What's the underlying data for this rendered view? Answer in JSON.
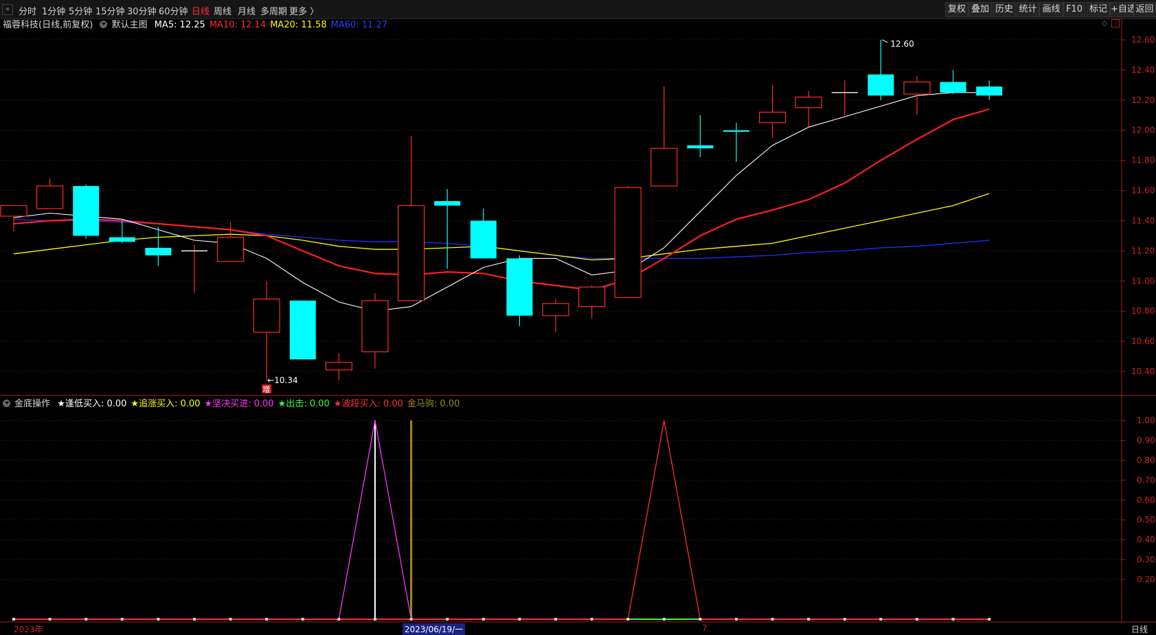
{
  "toolbar": {
    "timeframes": [
      "分时",
      "1分钟",
      "5分钟",
      "15分钟",
      "30分钟",
      "60分钟",
      "日线",
      "周线",
      "月线",
      "多周期",
      "更多 〉"
    ],
    "active_timeframe": "日线",
    "right_buttons": [
      "复权",
      "叠加",
      "历史",
      "统计",
      "画线",
      "F10",
      "标记",
      "+自选",
      "返回"
    ]
  },
  "main_header": {
    "stock": "福蓉科技(日线,前复权)",
    "template": "默认主图",
    "ma": [
      {
        "label": "MA5: 12.25",
        "color": "#ffffff"
      },
      {
        "label": "MA10: 12.14",
        "color": "#ff2b2b"
      },
      {
        "label": "MA20: 11.58",
        "color": "#ffff00"
      },
      {
        "label": "MA60: 11.27",
        "color": "#2f3cff"
      }
    ]
  },
  "sub_header": {
    "name": "金底操作",
    "items": [
      {
        "label": "★逢低买入: 0.00",
        "color": "#ffffff"
      },
      {
        "label": "★追涨买入: 0.00",
        "color": "#ffff00"
      },
      {
        "label": "★坚决买进: 0.00",
        "color": "#ff33ff"
      },
      {
        "label": "★出击: 0.00",
        "color": "#33ff33"
      },
      {
        "label": "★波段买入: 0.00",
        "color": "#ff3030"
      },
      {
        "label": "金马驹: 0.00",
        "color": "#a08a20"
      }
    ]
  },
  "chart_data": [
    {
      "type": "candlestick",
      "title": "福蓉科技(日线,前复权)",
      "y_ticks": [
        "12.60",
        "12.40",
        "12.20",
        "12.00",
        "11.80",
        "11.60",
        "11.40",
        "11.20",
        "11.00",
        "10.80",
        "10.60",
        "10.40"
      ],
      "ylim": [
        10.25,
        12.7
      ],
      "candles": [
        {
          "o": 11.43,
          "h": 11.5,
          "l": 11.33,
          "c": 11.5
        },
        {
          "o": 11.48,
          "h": 11.68,
          "l": 11.48,
          "c": 11.63
        },
        {
          "o": 11.63,
          "h": 11.64,
          "l": 11.28,
          "c": 11.3
        },
        {
          "o": 11.29,
          "h": 11.4,
          "l": 11.25,
          "c": 11.26
        },
        {
          "o": 11.22,
          "h": 11.36,
          "l": 11.1,
          "c": 11.17
        },
        {
          "o": 11.2,
          "h": 11.24,
          "l": 10.92,
          "c": 11.2
        },
        {
          "o": 11.13,
          "h": 11.39,
          "l": 11.13,
          "c": 11.29
        },
        {
          "o": 10.66,
          "h": 11.0,
          "l": 10.34,
          "c": 10.88
        },
        {
          "o": 10.87,
          "h": 10.87,
          "l": 10.48,
          "c": 10.48
        },
        {
          "o": 10.41,
          "h": 10.52,
          "l": 10.34,
          "c": 10.46
        },
        {
          "o": 10.53,
          "h": 10.92,
          "l": 10.42,
          "c": 10.87
        },
        {
          "o": 10.87,
          "h": 11.96,
          "l": 10.87,
          "c": 11.5
        },
        {
          "o": 11.53,
          "h": 11.61,
          "l": 11.08,
          "c": 11.5
        },
        {
          "o": 11.4,
          "h": 11.48,
          "l": 11.15,
          "c": 11.15
        },
        {
          "o": 11.15,
          "h": 11.17,
          "l": 10.7,
          "c": 10.77
        },
        {
          "o": 10.77,
          "h": 10.88,
          "l": 10.66,
          "c": 10.85
        },
        {
          "o": 10.83,
          "h": 10.97,
          "l": 10.75,
          "c": 10.96
        },
        {
          "o": 10.89,
          "h": 11.63,
          "l": 10.89,
          "c": 11.62
        },
        {
          "o": 11.63,
          "h": 12.29,
          "l": 11.63,
          "c": 11.88
        },
        {
          "o": 11.9,
          "h": 12.1,
          "l": 11.82,
          "c": 11.88
        },
        {
          "o": 12.0,
          "h": 12.05,
          "l": 11.79,
          "c": 11.99
        },
        {
          "o": 12.05,
          "h": 12.3,
          "l": 11.95,
          "c": 12.12
        },
        {
          "o": 12.15,
          "h": 12.26,
          "l": 12.02,
          "c": 12.22
        },
        {
          "o": 12.25,
          "h": 12.33,
          "l": 12.1,
          "c": 12.25
        },
        {
          "o": 12.37,
          "h": 12.6,
          "l": 12.2,
          "c": 12.23
        },
        {
          "o": 12.24,
          "h": 12.36,
          "l": 12.1,
          "c": 12.32
        },
        {
          "o": 12.32,
          "h": 12.4,
          "l": 12.24,
          "c": 12.25
        },
        {
          "o": 12.29,
          "h": 12.33,
          "l": 12.2,
          "c": 12.23
        }
      ],
      "ma5": [
        11.42,
        11.45,
        11.43,
        11.41,
        11.34,
        11.27,
        11.25,
        11.15,
        10.99,
        10.86,
        10.8,
        10.83,
        10.96,
        11.09,
        11.15,
        11.15,
        11.04,
        11.07,
        11.22,
        11.46,
        11.7,
        11.9,
        12.02,
        12.09,
        12.16,
        12.23,
        12.25,
        12.25
      ],
      "ma10": [
        11.38,
        11.4,
        11.41,
        11.4,
        11.38,
        11.36,
        11.34,
        11.3,
        11.2,
        11.1,
        11.05,
        11.04,
        11.06,
        11.05,
        11.0,
        10.97,
        10.94,
        11.01,
        11.15,
        11.3,
        11.41,
        11.47,
        11.54,
        11.65,
        11.8,
        11.94,
        12.07,
        12.14
      ],
      "ma20": [
        11.18,
        11.21,
        11.24,
        11.27,
        11.29,
        11.3,
        11.31,
        11.3,
        11.27,
        11.23,
        11.21,
        11.21,
        11.22,
        11.23,
        11.2,
        11.17,
        11.14,
        11.15,
        11.18,
        11.21,
        11.23,
        11.25,
        11.3,
        11.35,
        11.4,
        11.45,
        11.5,
        11.58
      ],
      "ma60": [
        11.41,
        11.4,
        11.4,
        11.39,
        11.38,
        11.36,
        11.34,
        11.31,
        11.29,
        11.27,
        11.26,
        11.26,
        11.25,
        11.23,
        11.2,
        11.17,
        11.15,
        11.15,
        11.15,
        11.15,
        11.16,
        11.17,
        11.19,
        11.2,
        11.22,
        11.23,
        11.25,
        11.27
      ],
      "annotations": [
        {
          "label": "12.60",
          "index": 24,
          "value": 12.6
        },
        {
          "label": "←10.34",
          "index": 7,
          "value": 10.34
        },
        {
          "label": "增",
          "index": 7
        }
      ]
    },
    {
      "type": "line",
      "title": "金底操作",
      "y_ticks": [
        "1.00",
        "0.90",
        "0.80",
        "0.70",
        "0.60",
        "0.50",
        "0.40",
        "0.30",
        "0.20"
      ],
      "ylim": [
        0,
        1.05
      ],
      "series": [
        {
          "name": "★逢低买入",
          "color": "#ffffff",
          "values": [
            0,
            0,
            0,
            0,
            0,
            0,
            0,
            0,
            0,
            0,
            1,
            0,
            0,
            0,
            0,
            0,
            0,
            0,
            0,
            0,
            0,
            0,
            0,
            0,
            0,
            0,
            0,
            0
          ]
        },
        {
          "name": "★追涨买入",
          "color": "#ffff00",
          "values": [
            0,
            0,
            0,
            0,
            0,
            0,
            0,
            0,
            0,
            0,
            0,
            1,
            0,
            0,
            0,
            0,
            0,
            0,
            0,
            0,
            0,
            0,
            0,
            0,
            0,
            0,
            0,
            0
          ]
        },
        {
          "name": "★坚决买进",
          "color": "#ff33ff",
          "values": [
            0,
            0,
            0,
            0,
            0,
            0,
            0,
            0,
            0,
            0,
            1,
            0,
            0,
            0,
            0,
            0,
            0,
            0,
            0,
            0,
            0,
            0,
            0,
            0,
            0,
            0,
            0,
            0
          ]
        },
        {
          "name": "★出击",
          "color": "#33ff33",
          "values": [
            0,
            0,
            0,
            0,
            0,
            0,
            0,
            0,
            0,
            0,
            0,
            0,
            0,
            0,
            0,
            0,
            0,
            0,
            0,
            0,
            0,
            0,
            0,
            0,
            0,
            0,
            0,
            0
          ]
        },
        {
          "name": "★波段买入",
          "color": "#ff3030",
          "values": [
            0,
            0,
            0,
            0,
            0,
            0,
            0,
            0,
            0,
            0,
            0,
            0,
            0,
            0,
            0,
            0,
            0,
            0,
            1,
            0,
            0,
            0,
            0,
            0,
            0,
            0,
            0,
            0
          ]
        }
      ],
      "x_labels": [
        {
          "label": "2023年",
          "index": 0
        },
        {
          "label": "2023/06/19/一",
          "index": 11
        },
        {
          "label": "7",
          "index": 19
        }
      ],
      "period_label": "日线"
    }
  ]
}
